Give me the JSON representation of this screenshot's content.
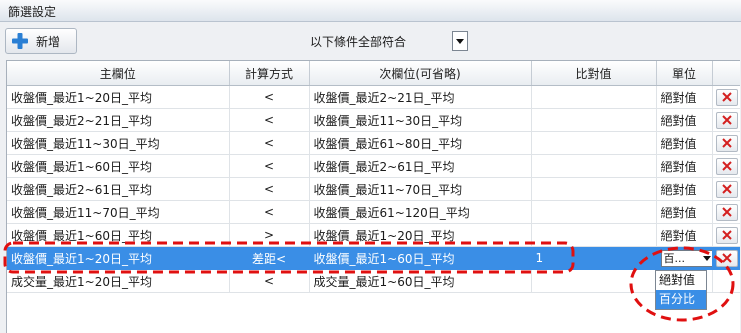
{
  "window": {
    "title": "篩選設定"
  },
  "toolbar": {
    "add_label": "新增",
    "match_mode": "以下條件全部符合"
  },
  "columns": {
    "main": "主欄位",
    "method": "計算方式",
    "secondary": "次欄位(可省略)",
    "value": "比對值",
    "unit": "單位"
  },
  "rows": [
    {
      "main": "收盤價_最近1~20日_平均",
      "method": "<",
      "secondary": "收盤價_最近2~21日_平均",
      "value": "",
      "unit": "絕對值"
    },
    {
      "main": "收盤價_最近2~21日_平均",
      "method": "<",
      "secondary": "收盤價_最近11~30日_平均",
      "value": "",
      "unit": "絕對值"
    },
    {
      "main": "收盤價_最近11~30日_平均",
      "method": "<",
      "secondary": "收盤價_最近61~80日_平均",
      "value": "",
      "unit": "絕對值"
    },
    {
      "main": "收盤價_最近1~60日_平均",
      "method": "<",
      "secondary": "收盤價_最近2~61日_平均",
      "value": "",
      "unit": "絕對值"
    },
    {
      "main": "收盤價_最近2~61日_平均",
      "method": "<",
      "secondary": "收盤價_最近11~70日_平均",
      "value": "",
      "unit": "絕對值"
    },
    {
      "main": "收盤價_最近11~70日_平均",
      "method": "<",
      "secondary": "收盤價_最近61~120日_平均",
      "value": "",
      "unit": "絕對值"
    },
    {
      "main": "收盤價_最近1~60日_平均",
      "method": ">",
      "secondary": "收盤價_最近1~20日_平均",
      "value": "",
      "unit": "絕對值"
    }
  ],
  "selected_row": {
    "main": "收盤價_最近1~20日_平均",
    "method": "差距<",
    "secondary": "收盤價_最近1~60日_平均",
    "value": "1",
    "unit": "百..."
  },
  "last_row": {
    "main": "成交量_最近1~20日_平均",
    "method": "<",
    "secondary": "成交量_最近1~60日_平均",
    "value": ""
  },
  "unit_options": [
    "絕對值",
    "百分比"
  ],
  "colors": {
    "selection": "#3a8ee6",
    "annotation": "#e01010",
    "delete": "#d42020",
    "add": "#2a7fd4"
  }
}
